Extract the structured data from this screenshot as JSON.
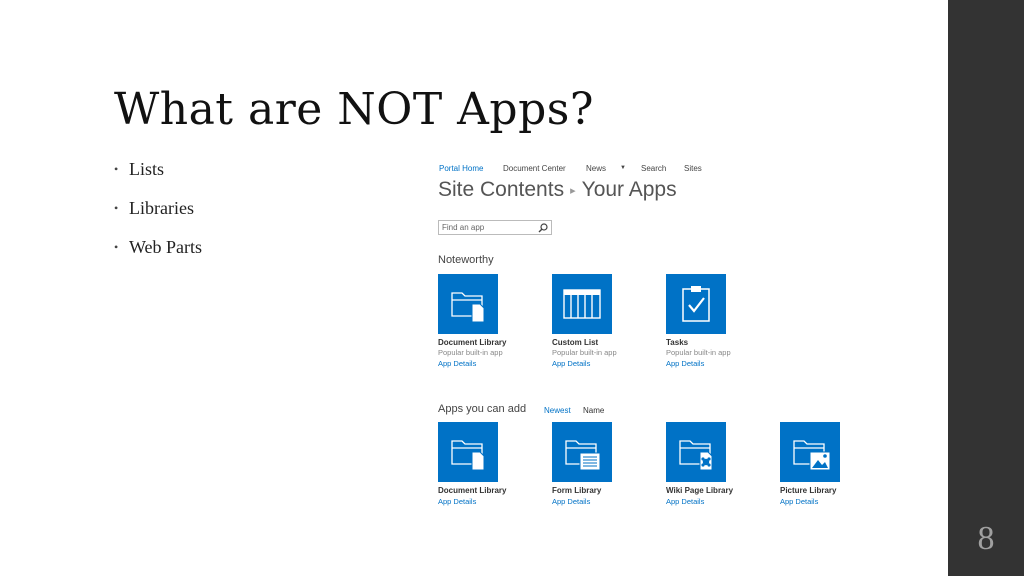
{
  "slide": {
    "title": "What are NOT Apps?",
    "bullets": [
      "Lists",
      "Libraries",
      "Web Parts"
    ],
    "page_number": "8"
  },
  "sharepoint": {
    "nav": {
      "portal_home": "Portal Home",
      "document_center": "Document Center",
      "news": "News",
      "search": "Search",
      "sites": "Sites"
    },
    "breadcrumb": {
      "site_contents": "Site Contents",
      "separator": "▸",
      "your_apps": "Your Apps"
    },
    "search": {
      "placeholder": "Find an app"
    },
    "noteworthy": {
      "title": "Noteworthy",
      "tiles": [
        {
          "name": "Document Library",
          "subtitle": "Popular built-in app",
          "link": "App Details",
          "icon": "document-library-icon"
        },
        {
          "name": "Custom List",
          "subtitle": "Popular built-in app",
          "link": "App Details",
          "icon": "custom-list-icon"
        },
        {
          "name": "Tasks",
          "subtitle": "Popular built-in app",
          "link": "App Details",
          "icon": "tasks-icon"
        }
      ]
    },
    "apps_you_can_add": {
      "title": "Apps you can add",
      "sort_newest": "Newest",
      "sort_name": "Name",
      "tiles": [
        {
          "name": "Document Library",
          "link": "App Details",
          "icon": "document-library-icon"
        },
        {
          "name": "Form Library",
          "link": "App Details",
          "icon": "form-library-icon"
        },
        {
          "name": "Wiki Page Library",
          "link": "App Details",
          "icon": "wiki-page-library-icon"
        },
        {
          "name": "Picture Library",
          "link": "App Details",
          "icon": "picture-library-icon"
        }
      ]
    },
    "colors": {
      "tile_blue": "#0072c6",
      "link_blue": "#0072c6",
      "sidebar_dark": "#333333"
    }
  }
}
